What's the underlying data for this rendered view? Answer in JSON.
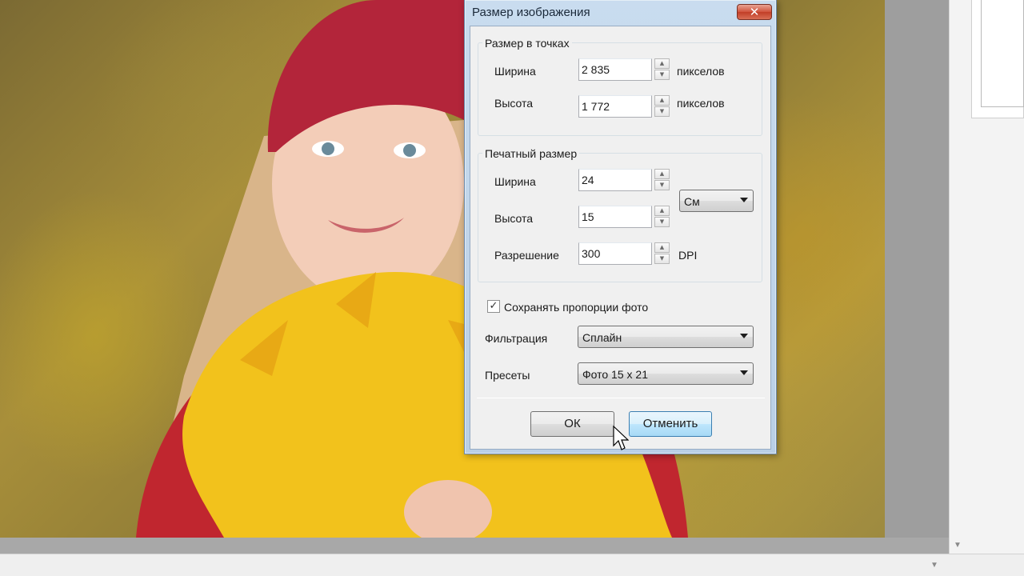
{
  "dialog": {
    "title": "Размер изображения",
    "close_symbol": "✕",
    "pixel_group": {
      "legend": "Размер в точках",
      "width_label": "Ширина",
      "width_value": "2 835",
      "width_unit": "пикселов",
      "height_label": "Высота",
      "height_value": "1 772",
      "height_unit": "пикселов"
    },
    "print_group": {
      "legend": "Печатный размер",
      "width_label": "Ширина",
      "width_value": "24",
      "height_label": "Высота",
      "height_value": "15",
      "resolution_label": "Разрешение",
      "resolution_value": "300",
      "resolution_unit": "DPI",
      "unit_selected": "См"
    },
    "keep_proportions": {
      "label": "Сохранять пропорции фото",
      "checked": true,
      "check_glyph": "✓"
    },
    "filter": {
      "label": "Фильтрация",
      "selected": "Сплайн"
    },
    "presets": {
      "label": "Пресеты",
      "selected": "Фото 15 x 21"
    },
    "buttons": {
      "ok": "ОК",
      "cancel": "Отменить"
    }
  },
  "scroll": {
    "down_arrow": "▼",
    "right_arrow": "▼"
  },
  "colors": {
    "hat": "#b3253a",
    "leaves": "#f2c21c",
    "coat": "#c0262f",
    "skin": "#f3cdb8",
    "hair": "#d9b58a"
  },
  "icons": {
    "spin_up": "▲",
    "spin_down": "▼"
  }
}
